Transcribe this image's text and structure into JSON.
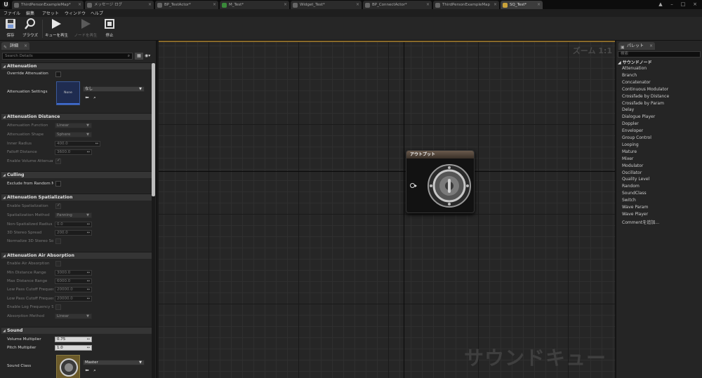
{
  "tabs": [
    {
      "label": "ThirdPersonExampleMap*",
      "active": false
    },
    {
      "label": "メッセージ ログ",
      "active": false
    },
    {
      "label": "BP_TestActor*",
      "active": false
    },
    {
      "label": "M_Test*",
      "active": false
    },
    {
      "label": "Widget_Test*",
      "active": false
    },
    {
      "label": "BP_ConnectActor*",
      "active": false
    },
    {
      "label": "ThirdPersonExampleMap",
      "active": false
    },
    {
      "label": "SQ_Test*",
      "active": true
    }
  ],
  "menu": [
    "ファイル",
    "編集",
    "アセット",
    "ウィンドウ",
    "ヘルプ"
  ],
  "toolbar": {
    "save": "保存",
    "browse": "ブラウズ",
    "play_cue": "キューを再生",
    "play_node": "ノードを再生",
    "stop": "停止"
  },
  "details": {
    "tab_label": "詳細",
    "search_placeholder": "Search Details",
    "sections": {
      "attenuation": {
        "title": "Attenuation",
        "override_label": "Override Attenuation",
        "settings_label": "Attenuation Settings",
        "thumb_text": "None",
        "combo_value": "なし"
      },
      "attenuation_distance": {
        "title": "Attenuation Distance",
        "function_label": "Attenuation Function",
        "function_value": "Linear",
        "shape_label": "Attenuation Shape",
        "shape_value": "Sphere",
        "inner_label": "Inner Radius",
        "inner_value": "400.0",
        "falloff_label": "Falloff Distance",
        "falloff_value": "3600.0",
        "enable_label": "Enable Volume Attenuati"
      },
      "culling": {
        "title": "Culling",
        "exclude_label": "Exclude from Random No"
      },
      "spatialization": {
        "title": "Attenuation Spatialization",
        "enable_label": "Enable Spatialization",
        "method_label": "Spatialization Method",
        "method_value": "Panning",
        "nonspatial_label": "Non-Spatialized Radius",
        "nonspatial_value": "0.0",
        "stereo_label": "3D Stereo Spread",
        "stereo_value": "200.0",
        "normalize_label": "Normalize 3D Stereo Sou"
      },
      "air_absorption": {
        "title": "Attenuation Air Absorption",
        "enable_label": "Enable Air Absorption",
        "min_label": "Min Distance Range",
        "min_value": "3000.0",
        "max_label": "Max Distance Range",
        "max_value": "6000.0",
        "lowpass_label": "Low Pass Cutoff Frequen",
        "lowpass_value": "20000.0",
        "lowpass2_label": "Low Pass Cutoff Frequen",
        "lowpass2_value": "20000.0",
        "log_label": "Enable Log Frequency Sc",
        "method_label": "Absorption Method",
        "method_value": "Linear"
      },
      "sound": {
        "title": "Sound",
        "volume_label": "Volume Multiplier",
        "volume_value": "0.75",
        "pitch_label": "Pitch Multiplier",
        "pitch_value": "1.0",
        "class_label": "Sound Class",
        "class_value": "Master"
      }
    }
  },
  "graph": {
    "zoom": "ズーム 1:1",
    "watermark": "サウンドキュー",
    "node_title": "アウトプット"
  },
  "palette": {
    "tab_label": "パレット",
    "search_placeholder": "検索",
    "category": "サウンドノード",
    "items": [
      "Attenuation",
      "Branch",
      "Concatenator",
      "Continuous Modulator",
      "Crossfade by Distance",
      "Crossfade by Param",
      "Delay",
      "Dialogue Player",
      "Doppler",
      "Enveloper",
      "Group Control",
      "Looping",
      "Mature",
      "Mixer",
      "Modulator",
      "Oscillator",
      "Quality Level",
      "Random",
      "SoundClass",
      "Switch",
      "Wave Param",
      "Wave Player",
      "Commentを追加..."
    ]
  }
}
